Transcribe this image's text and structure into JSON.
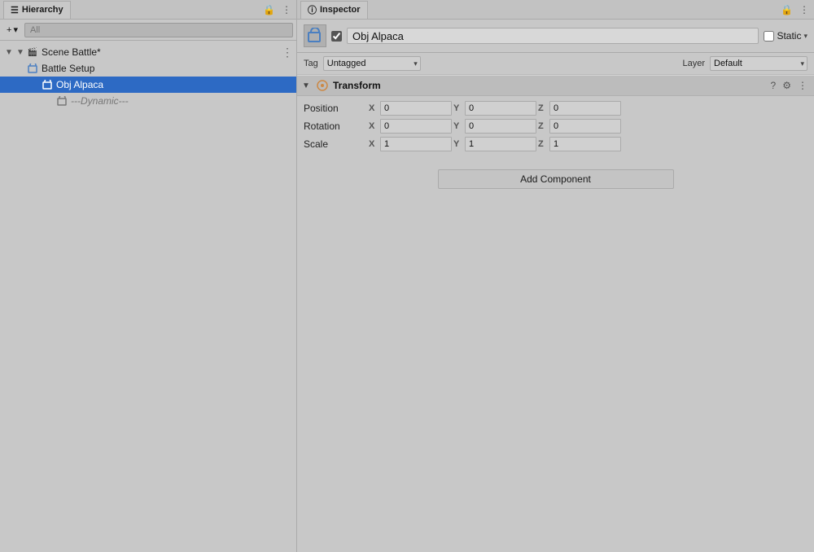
{
  "hierarchy": {
    "panel_title": "Hierarchy",
    "search_placeholder": "All",
    "tree": [
      {
        "id": "scene",
        "label": "Scene Battle*",
        "depth": 0,
        "type": "scene",
        "arrow": "▼",
        "selected": false,
        "dashed": false
      },
      {
        "id": "battle-setup",
        "label": "Battle Setup",
        "depth": 1,
        "type": "cube",
        "arrow": "",
        "selected": false,
        "dashed": false
      },
      {
        "id": "obj-alpaca",
        "label": "Obj Alpaca",
        "depth": 2,
        "type": "cube",
        "arrow": "",
        "selected": true,
        "dashed": false
      },
      {
        "id": "dynamic",
        "label": "---Dynamic---",
        "depth": 3,
        "type": "cube",
        "arrow": "",
        "selected": false,
        "dashed": true
      }
    ]
  },
  "inspector": {
    "panel_title": "Inspector",
    "object_name": "Obj Alpaca",
    "object_checked": true,
    "static_label": "Static",
    "tag_label": "Tag",
    "tag_value": "Untagged",
    "layer_label": "Layer",
    "layer_value": "Default",
    "transform": {
      "title": "Transform",
      "position": {
        "label": "Position",
        "x": "0",
        "y": "0",
        "z": "0"
      },
      "rotation": {
        "label": "Rotation",
        "x": "0",
        "y": "0",
        "z": "0"
      },
      "scale": {
        "label": "Scale",
        "x": "1",
        "y": "1",
        "z": "1"
      }
    },
    "add_component_label": "Add Component"
  },
  "icons": {
    "hierarchy": "☰",
    "lock": "🔒",
    "more": "⋮",
    "add": "+",
    "arrow_down": "▾",
    "arrow_right": "▸",
    "fold": "▼",
    "help": "?",
    "settings": "⚙",
    "info": "ⓘ"
  }
}
